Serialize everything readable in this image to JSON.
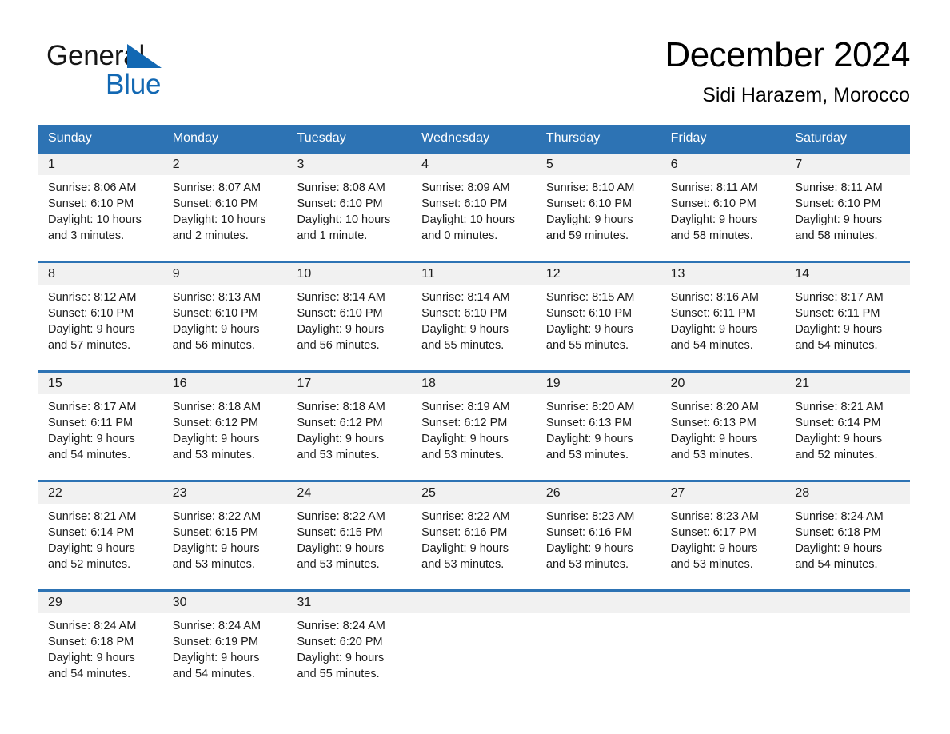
{
  "brand": {
    "word1": "General",
    "word2": "Blue",
    "triangle_color": "#1268b3"
  },
  "header": {
    "title": "December 2024",
    "subtitle": "Sidi Harazem, Morocco"
  },
  "theme": {
    "header_blue": "#2d73b4",
    "daynum_band": "#f1f1f1",
    "text": "#1b1b1b"
  },
  "weekdays": [
    "Sunday",
    "Monday",
    "Tuesday",
    "Wednesday",
    "Thursday",
    "Friday",
    "Saturday"
  ],
  "weeks": [
    [
      {
        "day": "1",
        "sunrise": "Sunrise: 8:06 AM",
        "sunset": "Sunset: 6:10 PM",
        "daylight": "Daylight: 10 hours and 3 minutes."
      },
      {
        "day": "2",
        "sunrise": "Sunrise: 8:07 AM",
        "sunset": "Sunset: 6:10 PM",
        "daylight": "Daylight: 10 hours and 2 minutes."
      },
      {
        "day": "3",
        "sunrise": "Sunrise: 8:08 AM",
        "sunset": "Sunset: 6:10 PM",
        "daylight": "Daylight: 10 hours and 1 minute."
      },
      {
        "day": "4",
        "sunrise": "Sunrise: 8:09 AM",
        "sunset": "Sunset: 6:10 PM",
        "daylight": "Daylight: 10 hours and 0 minutes."
      },
      {
        "day": "5",
        "sunrise": "Sunrise: 8:10 AM",
        "sunset": "Sunset: 6:10 PM",
        "daylight": "Daylight: 9 hours and 59 minutes."
      },
      {
        "day": "6",
        "sunrise": "Sunrise: 8:11 AM",
        "sunset": "Sunset: 6:10 PM",
        "daylight": "Daylight: 9 hours and 58 minutes."
      },
      {
        "day": "7",
        "sunrise": "Sunrise: 8:11 AM",
        "sunset": "Sunset: 6:10 PM",
        "daylight": "Daylight: 9 hours and 58 minutes."
      }
    ],
    [
      {
        "day": "8",
        "sunrise": "Sunrise: 8:12 AM",
        "sunset": "Sunset: 6:10 PM",
        "daylight": "Daylight: 9 hours and 57 minutes."
      },
      {
        "day": "9",
        "sunrise": "Sunrise: 8:13 AM",
        "sunset": "Sunset: 6:10 PM",
        "daylight": "Daylight: 9 hours and 56 minutes."
      },
      {
        "day": "10",
        "sunrise": "Sunrise: 8:14 AM",
        "sunset": "Sunset: 6:10 PM",
        "daylight": "Daylight: 9 hours and 56 minutes."
      },
      {
        "day": "11",
        "sunrise": "Sunrise: 8:14 AM",
        "sunset": "Sunset: 6:10 PM",
        "daylight": "Daylight: 9 hours and 55 minutes."
      },
      {
        "day": "12",
        "sunrise": "Sunrise: 8:15 AM",
        "sunset": "Sunset: 6:10 PM",
        "daylight": "Daylight: 9 hours and 55 minutes."
      },
      {
        "day": "13",
        "sunrise": "Sunrise: 8:16 AM",
        "sunset": "Sunset: 6:11 PM",
        "daylight": "Daylight: 9 hours and 54 minutes."
      },
      {
        "day": "14",
        "sunrise": "Sunrise: 8:17 AM",
        "sunset": "Sunset: 6:11 PM",
        "daylight": "Daylight: 9 hours and 54 minutes."
      }
    ],
    [
      {
        "day": "15",
        "sunrise": "Sunrise: 8:17 AM",
        "sunset": "Sunset: 6:11 PM",
        "daylight": "Daylight: 9 hours and 54 minutes."
      },
      {
        "day": "16",
        "sunrise": "Sunrise: 8:18 AM",
        "sunset": "Sunset: 6:12 PM",
        "daylight": "Daylight: 9 hours and 53 minutes."
      },
      {
        "day": "17",
        "sunrise": "Sunrise: 8:18 AM",
        "sunset": "Sunset: 6:12 PM",
        "daylight": "Daylight: 9 hours and 53 minutes."
      },
      {
        "day": "18",
        "sunrise": "Sunrise: 8:19 AM",
        "sunset": "Sunset: 6:12 PM",
        "daylight": "Daylight: 9 hours and 53 minutes."
      },
      {
        "day": "19",
        "sunrise": "Sunrise: 8:20 AM",
        "sunset": "Sunset: 6:13 PM",
        "daylight": "Daylight: 9 hours and 53 minutes."
      },
      {
        "day": "20",
        "sunrise": "Sunrise: 8:20 AM",
        "sunset": "Sunset: 6:13 PM",
        "daylight": "Daylight: 9 hours and 53 minutes."
      },
      {
        "day": "21",
        "sunrise": "Sunrise: 8:21 AM",
        "sunset": "Sunset: 6:14 PM",
        "daylight": "Daylight: 9 hours and 52 minutes."
      }
    ],
    [
      {
        "day": "22",
        "sunrise": "Sunrise: 8:21 AM",
        "sunset": "Sunset: 6:14 PM",
        "daylight": "Daylight: 9 hours and 52 minutes."
      },
      {
        "day": "23",
        "sunrise": "Sunrise: 8:22 AM",
        "sunset": "Sunset: 6:15 PM",
        "daylight": "Daylight: 9 hours and 53 minutes."
      },
      {
        "day": "24",
        "sunrise": "Sunrise: 8:22 AM",
        "sunset": "Sunset: 6:15 PM",
        "daylight": "Daylight: 9 hours and 53 minutes."
      },
      {
        "day": "25",
        "sunrise": "Sunrise: 8:22 AM",
        "sunset": "Sunset: 6:16 PM",
        "daylight": "Daylight: 9 hours and 53 minutes."
      },
      {
        "day": "26",
        "sunrise": "Sunrise: 8:23 AM",
        "sunset": "Sunset: 6:16 PM",
        "daylight": "Daylight: 9 hours and 53 minutes."
      },
      {
        "day": "27",
        "sunrise": "Sunrise: 8:23 AM",
        "sunset": "Sunset: 6:17 PM",
        "daylight": "Daylight: 9 hours and 53 minutes."
      },
      {
        "day": "28",
        "sunrise": "Sunrise: 8:24 AM",
        "sunset": "Sunset: 6:18 PM",
        "daylight": "Daylight: 9 hours and 54 minutes."
      }
    ],
    [
      {
        "day": "29",
        "sunrise": "Sunrise: 8:24 AM",
        "sunset": "Sunset: 6:18 PM",
        "daylight": "Daylight: 9 hours and 54 minutes."
      },
      {
        "day": "30",
        "sunrise": "Sunrise: 8:24 AM",
        "sunset": "Sunset: 6:19 PM",
        "daylight": "Daylight: 9 hours and 54 minutes."
      },
      {
        "day": "31",
        "sunrise": "Sunrise: 8:24 AM",
        "sunset": "Sunset: 6:20 PM",
        "daylight": "Daylight: 9 hours and 55 minutes."
      },
      {
        "day": "",
        "sunrise": "",
        "sunset": "",
        "daylight": ""
      },
      {
        "day": "",
        "sunrise": "",
        "sunset": "",
        "daylight": ""
      },
      {
        "day": "",
        "sunrise": "",
        "sunset": "",
        "daylight": ""
      },
      {
        "day": "",
        "sunrise": "",
        "sunset": "",
        "daylight": ""
      }
    ]
  ]
}
